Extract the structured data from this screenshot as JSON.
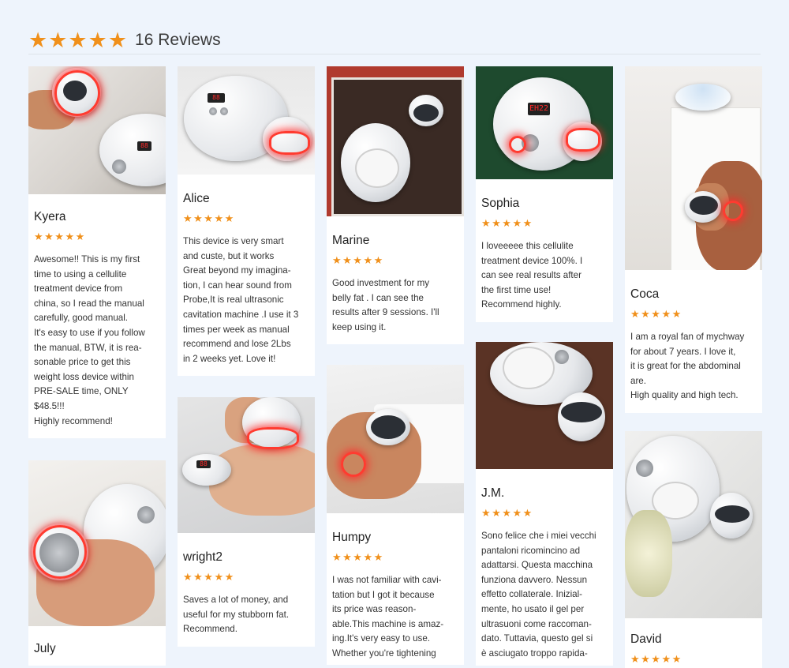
{
  "header": {
    "stars": "★★★★★",
    "title": "16 Reviews"
  },
  "reviews": [
    {
      "name": "Kyera",
      "stars": "★★★★★",
      "text": "Awesome!! This is my first\ntime to using a cellulite\ntreatment device from\nchina, so I read the manual\ncarefully, good manual.\nIt's easy to use if you follow\nthe manual, BTW, it is rea-\nsonable price to get this\nweight loss device within\nPRE-SALE time, ONLY\n$48.5!!!\nHighly recommend!"
    },
    {
      "name": "July",
      "stars": "★★★★★",
      "text": ""
    },
    {
      "name": "Alice",
      "stars": "★★★★★",
      "text": "This device is very smart\nand custe, but it works\nGreat beyond my imagina-\ntion, I can hear sound from\nProbe,It is real ultrasonic\ncavitation machine .I use it 3\ntimes per week as manual\nrecommend and lose 2Lbs\nin 2 weeks yet. Love it!"
    },
    {
      "name": "wright2",
      "stars": "★★★★★",
      "text": "Saves a lot of money, and\nuseful for my stubborn fat.\nRecommend."
    },
    {
      "name": "Marine",
      "stars": "★★★★★",
      "text": "Good investment for my\nbelly fat . I can see the\nresults after 9 sessions. I'll\nkeep using it."
    },
    {
      "name": "Humpy",
      "stars": "★★★★★",
      "text": "I was not familiar with cavi-\ntation but I got it because\nits price was reason-\nable.This machine is amaz-\ning.It's very easy to use.\nWhether you're tightening"
    },
    {
      "name": "Sophia",
      "stars": "★★★★★",
      "text": "I loveeeee this cellulite\ntreatment device 100%. I\ncan see real results after\nthe first time use!\nRecommend highly."
    },
    {
      "name": "J.M.",
      "stars": "★★★★★",
      "text": "Sono felice che i miei vecchi\npantaloni ricomincino ad\nadattarsi. Questa macchina\nfunziona davvero. Nessun\neffetto collaterale. Inizial-\nmente, ho usato il gel per\nultrasuoni come raccoman-\ndato. Tuttavia, questo gel si\nè asciugato troppo rapida-"
    },
    {
      "name": "Coca",
      "stars": "★★★★★",
      "text": "I am a royal fan of mychway\nfor about 7 years. I love it,\nit is great for the abdominal\nare.\nHigh quality and high tech."
    },
    {
      "name": "David",
      "stars": "★★★★★",
      "text": ""
    }
  ]
}
